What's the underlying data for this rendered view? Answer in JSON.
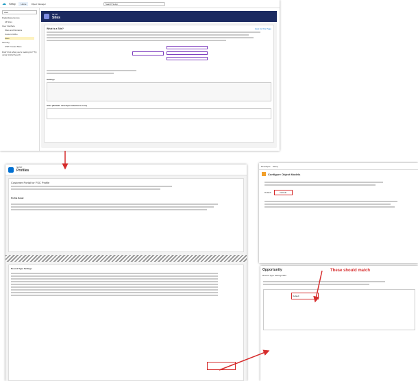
{
  "top": {
    "tab_home": "Home",
    "tab_object_manager": "Object Manager",
    "search": "Search Setup",
    "setup": "Setup"
  },
  "sidebar": {
    "search": "sites",
    "items": [
      "Digital Experiences",
      "All Sites",
      "User Interface",
      "Sites and Domains",
      "Custom URLs",
      "Sites",
      "Security",
      "CSP Trusted Sites"
    ],
    "footer": "Didn't find what you're looking for? Try using Global Search."
  },
  "sites": {
    "eyebrow": "SETUP",
    "title": "Sites",
    "help": "Help for this Page",
    "whatis": "What is a Site?",
    "domain_label": "Sites (Default: developer.salesforce.com)",
    "settings": "Settings"
  },
  "profiles": {
    "eyebrow": "SETUP",
    "title": "Profiles",
    "name": "Customer Portal for FSC Profile",
    "detail": "Profile Detail",
    "section": "Record Type Settings"
  },
  "objmodel": {
    "title": "Configure Object Models",
    "app": "Developer",
    "tab": "Setup",
    "default_label": "Default",
    "default_value": "Default"
  },
  "recordtype": {
    "title": "Opportunity",
    "detail": "Record Type Settings Edit",
    "value": "Default"
  },
  "annotation": {
    "text": "These should match"
  },
  "colors": {
    "brand": "#0070d2",
    "arrow": "#d62c2c",
    "header": "#1b2a60"
  }
}
